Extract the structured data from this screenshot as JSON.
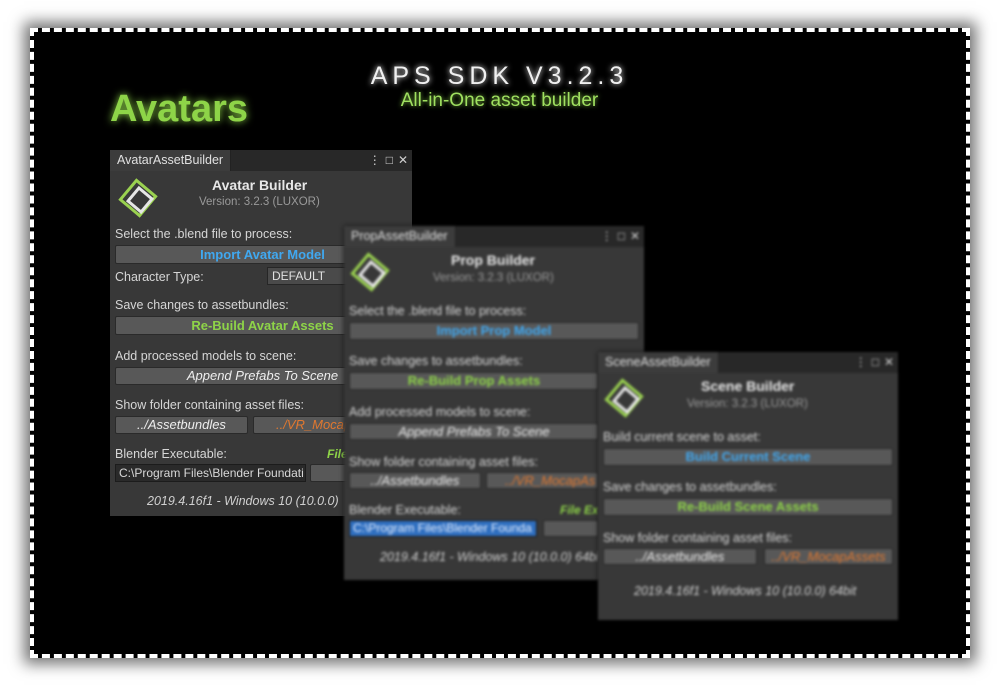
{
  "header": {
    "title": "APS SDK V3.2.3",
    "subtitle": "All-in-One asset builder",
    "section": "Avatars"
  },
  "avatar_panel": {
    "tab": "AvatarAssetBuilder",
    "title": "Avatar Builder",
    "version": "Version: 3.2.3 (LUXOR)",
    "select_label": "Select the .blend file to process:",
    "import_button": "Import Avatar Model",
    "char_type_label": "Character Type:",
    "char_type_value": "DEFAULT",
    "save_label": "Save changes to assetbundles:",
    "rebuild_button": "Re-Build Avatar Assets",
    "add_label": "Add processed models to scene:",
    "append_button": "Append Prefabs To Scene",
    "folder_label": "Show folder containing asset files:",
    "folder_btn1": "../Assetbundles",
    "folder_btn2": "../VR_Mocap",
    "blender_label": "Blender Executable:",
    "file_link": "File",
    "blender_path": "C:\\Program Files\\Blender Foundati",
    "footer": "2019.4.16f1 - Windows 10  (10.0.0)"
  },
  "prop_panel": {
    "tab": "PropAssetBuilder",
    "title": "Prop Builder",
    "version": "Version: 3.2.3 (LUXOR)",
    "select_label": "Select the .blend file to process:",
    "import_button": "Import Prop Model",
    "save_label": "Save changes to assetbundles:",
    "rebuild_button": "Re-Build Prop Assets",
    "add_label": "Add processed models to scene:",
    "append_button": "Append Prefabs To Scene",
    "folder_label": "Show folder containing asset files:",
    "folder_btn1": "../Assetbundles",
    "folder_btn2": "../VR_MocapAs",
    "blender_label": "Blender Executable:",
    "file_link": "File Ex",
    "blender_path": "C:\\Program Files\\Blender Founda",
    "footer": "2019.4.16f1 - Windows 10  (10.0.0) 64bi"
  },
  "scene_panel": {
    "tab": "SceneAssetBuilder",
    "title": "Scene Builder",
    "version": "Version: 3.2.3 (LUXOR)",
    "build_label": "Build current scene to asset:",
    "build_button": "Build Current Scene",
    "save_label": "Save changes to assetbundles:",
    "rebuild_button": "Re-Build Scene Assets",
    "folder_label": "Show folder containing asset files:",
    "folder_btn1": "../Assetbundles",
    "folder_btn2": "../VR_MocapAssets",
    "footer": "2019.4.16f1 - Windows 10  (10.0.0) 64bit"
  },
  "tab_icons": [
    "more-icon",
    "maximize-icon",
    "close-icon"
  ],
  "colors": {
    "accent_green": "#8ed448",
    "accent_blue": "#40a8f0",
    "accent_orange": "#e07830",
    "panel_bg": "#383838"
  }
}
